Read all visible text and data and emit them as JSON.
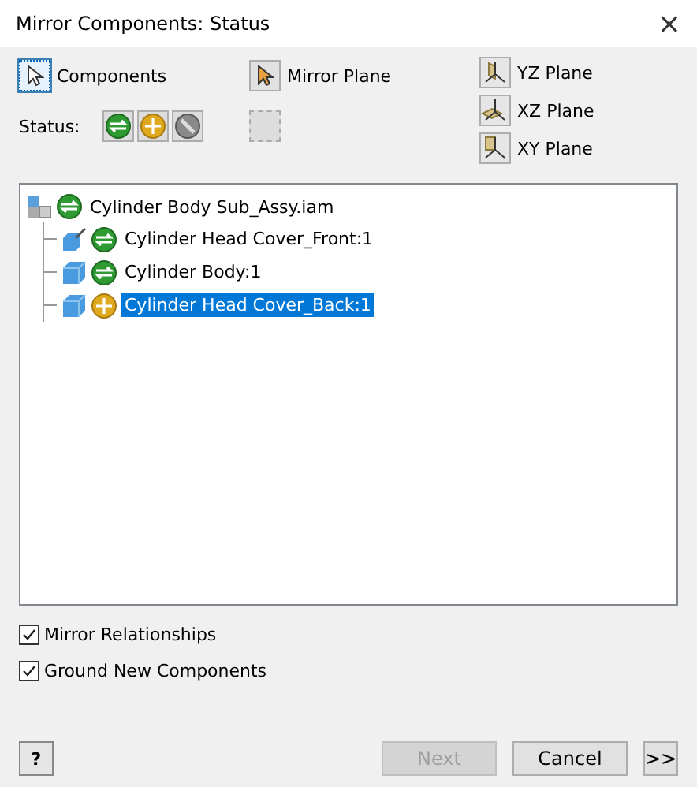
{
  "window": {
    "title": "Mirror Components: Status",
    "close": "×"
  },
  "pickers": [
    {
      "label": "Components",
      "selected": true
    },
    {
      "label": "Mirror Plane",
      "selected": false
    }
  ],
  "planes": [
    {
      "label": "YZ Plane",
      "kind": "yz"
    },
    {
      "label": "XZ Plane",
      "kind": "xz"
    },
    {
      "label": "XY Plane",
      "kind": "xy"
    }
  ],
  "status": {
    "label": "Status:",
    "buttons": [
      {
        "kind": "mirror"
      },
      {
        "kind": "reuse"
      },
      {
        "kind": "exclude"
      }
    ]
  },
  "tree": {
    "label": "Cylinder Body Sub_Assy.iam",
    "kind": "assembly",
    "status": {
      "kind": "mirror"
    },
    "selected": false,
    "children": [
      {
        "label": "Cylinder Head Cover_Front:1",
        "kind": "part-grounded",
        "status": {
          "kind": "mirror"
        },
        "selected": false
      },
      {
        "label": "Cylinder Body:1",
        "kind": "part",
        "status": {
          "kind": "mirror"
        },
        "selected": false
      },
      {
        "label": "Cylinder Head Cover_Back:1",
        "kind": "part",
        "status": {
          "kind": "reuse"
        },
        "selected": true
      }
    ]
  },
  "options": [
    {
      "label": "Mirror Relationships",
      "checked": true
    },
    {
      "label": "Ground New Components",
      "checked": true
    }
  ],
  "footer": {
    "help": "?",
    "buttons": [
      {
        "label": "Next",
        "disabled": true
      },
      {
        "label": "Cancel",
        "disabled": false
      },
      {
        "label": ">>",
        "disabled": false
      }
    ]
  }
}
